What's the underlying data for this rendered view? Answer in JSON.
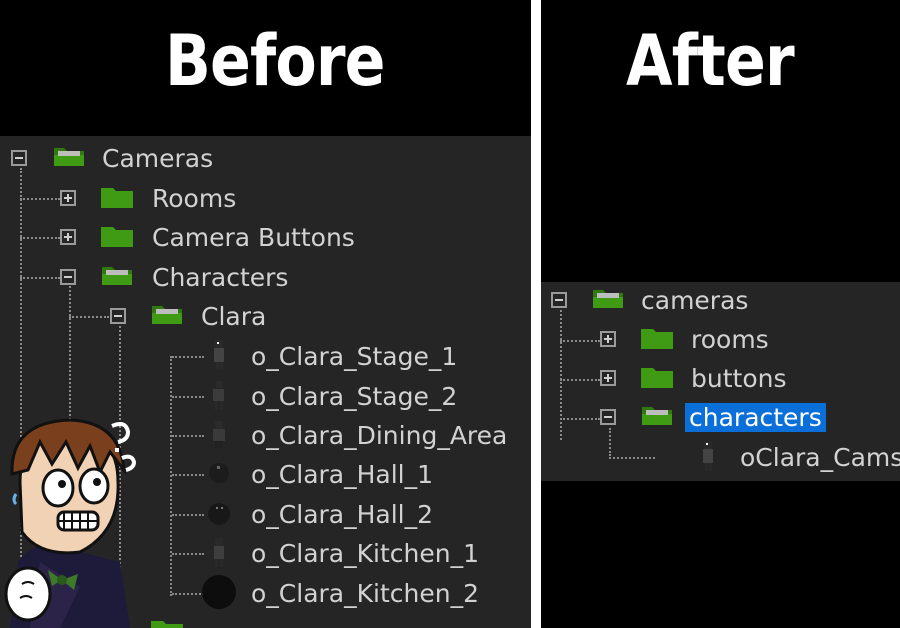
{
  "left": {
    "heading": "Before",
    "tree": {
      "root": "Cameras",
      "rooms": "Rooms",
      "camera_buttons": "Camera Buttons",
      "characters": "Characters",
      "clara": "Clara",
      "objects": [
        "o_Clara_Stage_1",
        "o_Clara_Stage_2",
        "o_Clara_Dining_Area",
        "o_Clara_Hall_1",
        "o_Clara_Hall_2",
        "o_Clara_Kitchen_1",
        "o_Clara_Kitchen_2"
      ]
    }
  },
  "right": {
    "heading": "After",
    "tree": {
      "root": "cameras",
      "rooms": "rooms",
      "buttons": "buttons",
      "characters": "characters",
      "object": "oClara_Cams"
    }
  },
  "colors": {
    "folder_green": "#3f9a14",
    "tree_background": "#252525",
    "selection_blue": "#0a6fd8"
  },
  "icons": [
    "folder-icon",
    "folder-open-icon",
    "expand-icon",
    "collapse-icon",
    "object-sprite-icon"
  ]
}
